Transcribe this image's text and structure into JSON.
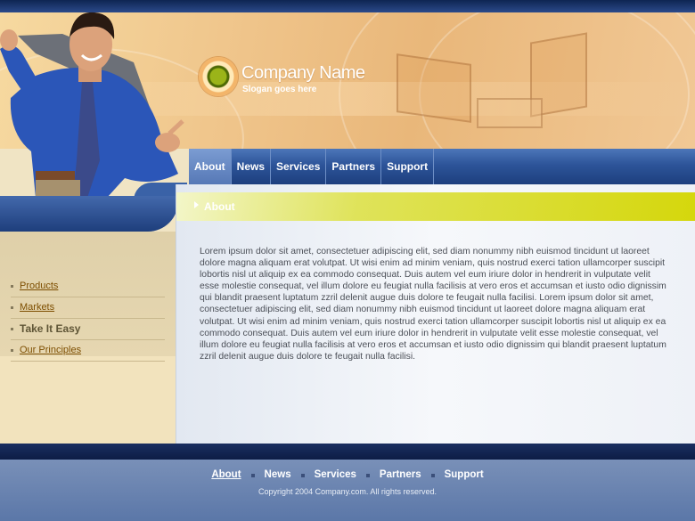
{
  "header": {
    "company_name": "Company Name",
    "slogan": "Slogan goes here"
  },
  "nav": {
    "items": [
      {
        "label": "About",
        "active": true
      },
      {
        "label": "News"
      },
      {
        "label": "Services"
      },
      {
        "label": "Partners"
      },
      {
        "label": "Support"
      }
    ]
  },
  "sidebar": {
    "items": [
      {
        "label": "Products",
        "link": true
      },
      {
        "label": "Markets",
        "link": true
      },
      {
        "label": "Take It Easy",
        "link": false
      },
      {
        "label": "Our Principles",
        "link": true
      }
    ]
  },
  "content": {
    "title": "About",
    "body": "Lorem ipsum dolor sit amet, consectetuer adipiscing elit, sed diam nonummy nibh euismod tincidunt ut laoreet dolore magna aliquam erat volutpat. Ut wisi enim ad minim veniam, quis nostrud exerci tation ullamcorper suscipit lobortis nisl ut aliquip ex ea commodo consequat. Duis autem vel eum iriure dolor in hendrerit in vulputate velit esse molestie consequat, vel illum dolore eu feugiat nulla facilisis at vero eros et accumsan et iusto odio dignissim qui blandit praesent luptatum zzril delenit augue duis dolore te feugait nulla facilisi. Lorem ipsum dolor sit amet, consectetuer adipiscing elit, sed diam nonummy nibh euismod tincidunt ut laoreet dolore magna aliquam erat volutpat. Ut wisi enim ad minim veniam, quis nostrud exerci tation ullamcorper suscipit lobortis nisl ut aliquip ex ea commodo consequat. Duis autem vel eum iriure dolor in hendrerit in vulputate velit esse molestie consequat, vel illum dolore eu feugiat nulla facilisis at vero eros et accumsan et iusto odio dignissim qui blandit praesent luptatum zzril delenit augue duis dolore te feugait nulla facilisi."
  },
  "footer": {
    "items": [
      "About",
      "News",
      "Services",
      "Partners",
      "Support"
    ],
    "copyright": "Copyright 2004 Company.com. All rights reserved."
  },
  "colors": {
    "nav_blue": "#2d5499",
    "title_bar_yellow": "#d5d70c",
    "sidebar_link": "#7d4e00",
    "footer_blue": "#5b77a8"
  }
}
